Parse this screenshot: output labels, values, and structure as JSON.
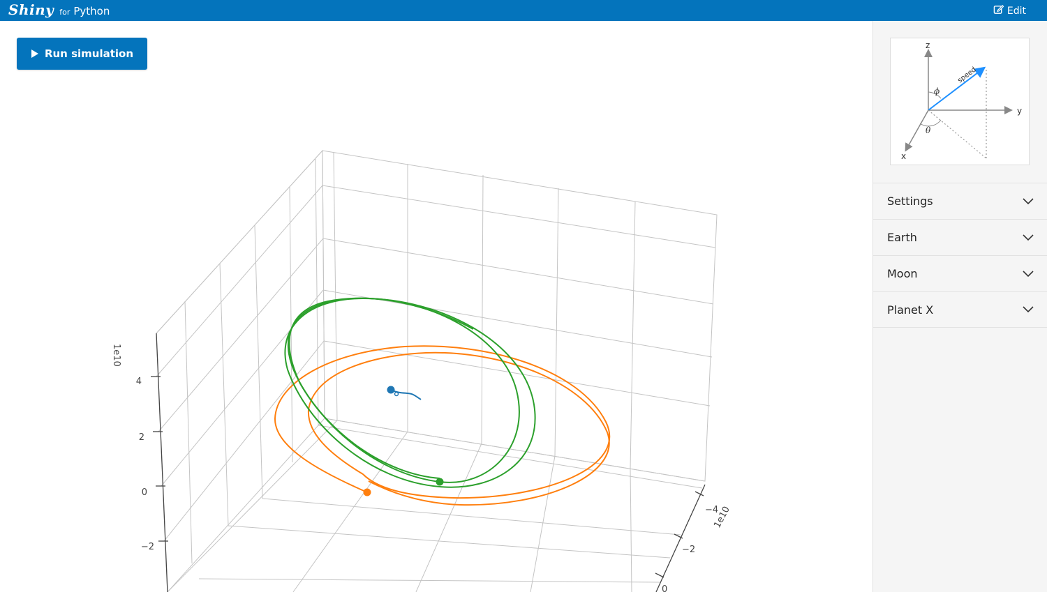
{
  "header": {
    "brand_logo": "Shiny",
    "brand_for": "for",
    "brand_python": "Python",
    "edit_label": "Edit"
  },
  "toolbar": {
    "run_label": "Run simulation"
  },
  "diagram": {
    "axis_z": "z",
    "axis_y": "y",
    "axis_x": "x",
    "speed_label": "speed",
    "phi_label": "ϕ",
    "theta_label": "θ"
  },
  "accordion": [
    {
      "label": "Settings"
    },
    {
      "label": "Earth"
    },
    {
      "label": "Moon"
    },
    {
      "label": "Planet X"
    }
  ],
  "colors": {
    "brand": "#0474bc",
    "earth": "#1f77b4",
    "moon": "#ff7f0e",
    "planet_x": "#2ca02c",
    "speed_arrow": "#1e90ff"
  },
  "chart_data": {
    "type": "scatter3d",
    "z_axis": {
      "exponent_label": "1e10",
      "ticks": [
        "4",
        "2",
        "0",
        "−2"
      ]
    },
    "x_axis": {
      "exponent_label": "1e10",
      "ticks": [
        "−4",
        "−2",
        "0"
      ]
    },
    "series": [
      {
        "name": "Earth",
        "color": "#1f77b4"
      },
      {
        "name": "Moon",
        "color": "#ff7f0e"
      },
      {
        "name": "Planet X",
        "color": "#2ca02c"
      }
    ],
    "grid": true
  }
}
